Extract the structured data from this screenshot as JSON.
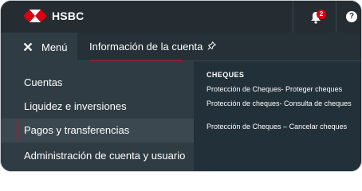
{
  "topbar": {
    "brand": "HSBC",
    "notifications_count": "2",
    "help_symbol": "?"
  },
  "menu_row": {
    "menu_label": "Menú",
    "active_tab": "Información de la cuenta"
  },
  "left_nav": {
    "items": [
      {
        "label": "Cuentas"
      },
      {
        "label": "Liquidez e inversiones"
      },
      {
        "label": "Pagos y transferencias"
      },
      {
        "label": "Administración de cuenta y usuario"
      }
    ]
  },
  "right_panel": {
    "section_title": "CHEQUES",
    "links": [
      {
        "label": "Protección de Cheques- Proteger cheques"
      },
      {
        "label": "Protección de cheques- Consulta de cheques"
      },
      {
        "label": "Protección de Cheques – Cancelar cheques"
      }
    ]
  },
  "colors": {
    "accent": "#db0011",
    "topbar": "#252d32",
    "nav_bg": "#2f3c44",
    "panel_bg": "#22303a"
  },
  "icons": [
    "hsbc-logo-icon",
    "close-icon",
    "pin-icon",
    "bell-icon",
    "help-icon"
  ]
}
